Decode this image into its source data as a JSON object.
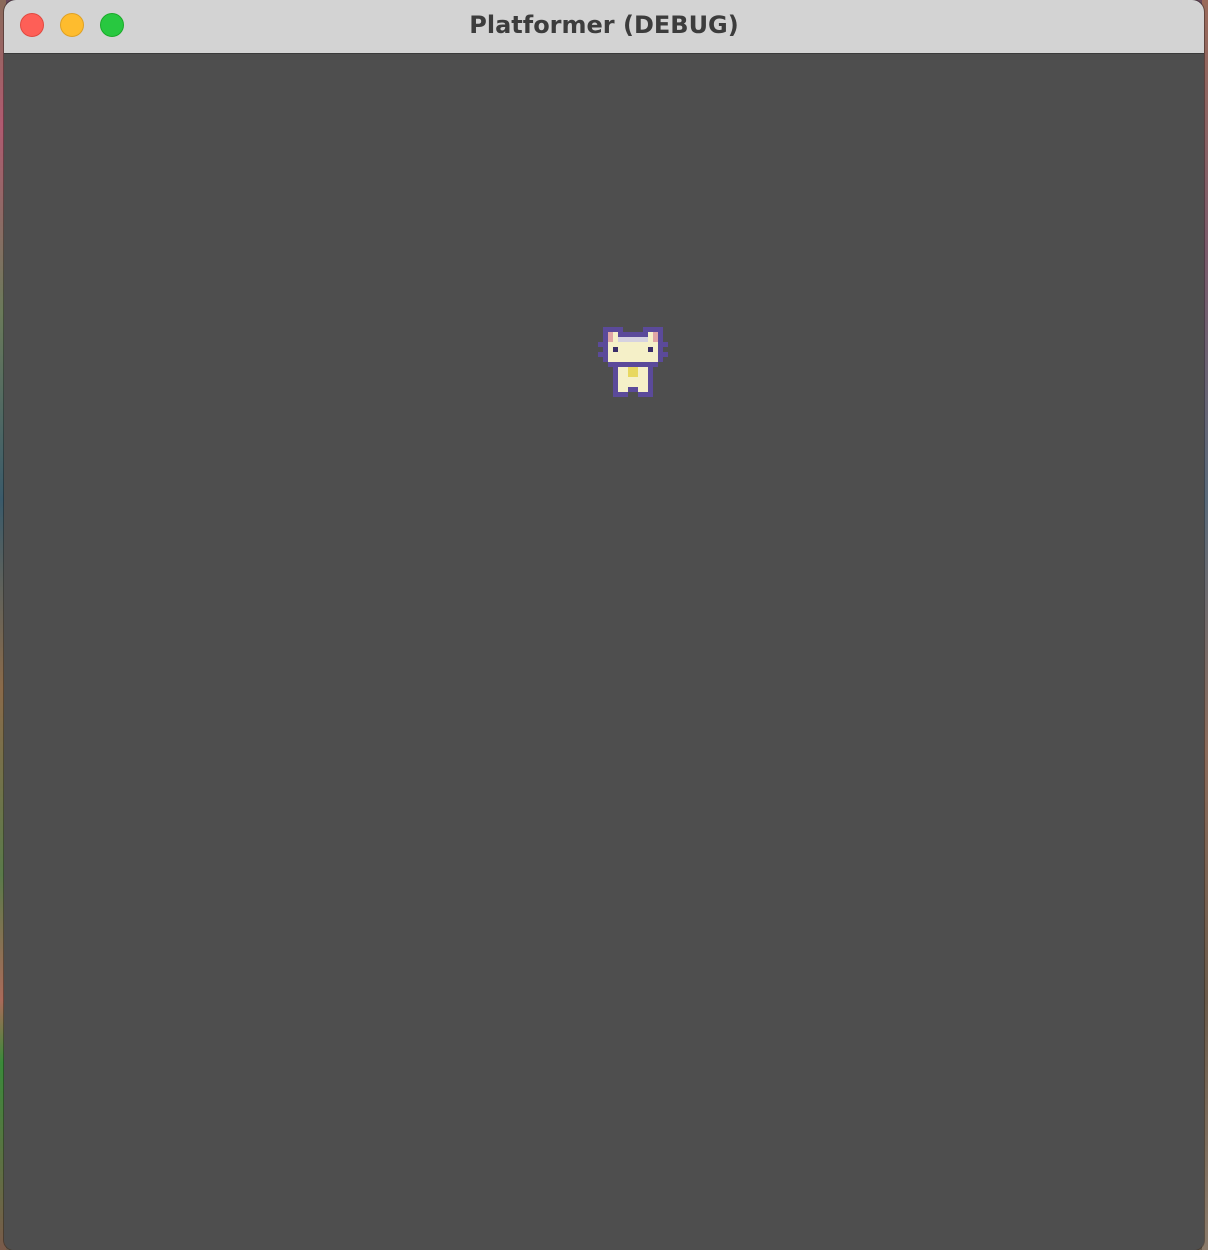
{
  "window": {
    "title": "Platformer (DEBUG)",
    "controls": [
      "close",
      "minimize",
      "zoom"
    ]
  },
  "viewport": {
    "background_color": "#4e4e4e"
  },
  "player": {
    "sprite": "cat-character",
    "colors": {
      "outline": "#5b4a9a",
      "body": "#f5f0c8",
      "head_band": "#d6d2e0",
      "ear_inner": "#e0a6a6",
      "eyes": "#3a2e6a",
      "collar": "#e8d860"
    }
  }
}
